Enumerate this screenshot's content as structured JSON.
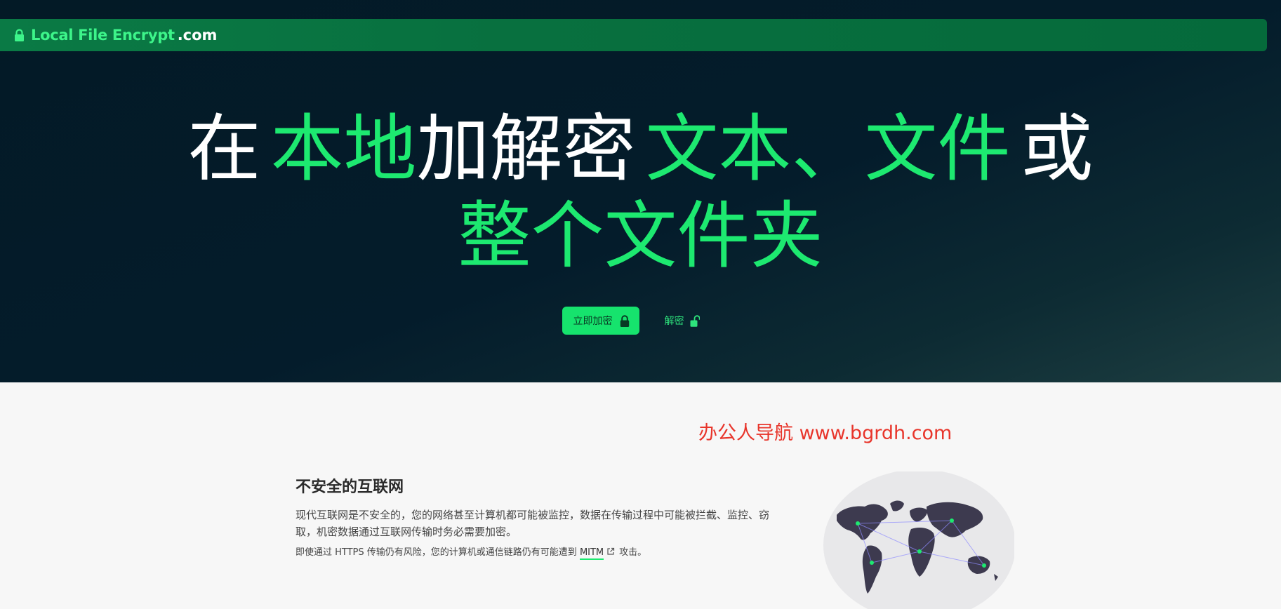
{
  "brand": {
    "name": "Local File Encrypt",
    "suffix": ".com"
  },
  "hero": {
    "line1": {
      "w1": "在",
      "g1": "本地",
      "w2": "加解密",
      "g2": "文本、",
      "g3": "文件",
      "w3": "或"
    },
    "line2": "整个文件夹",
    "encrypt_label": "立即加密",
    "decrypt_label": "解密"
  },
  "watermark": "办公人导航 www.bgrdh.com",
  "section": {
    "title": "不安全的互联网",
    "p1": "现代互联网是不安全的，您的网络甚至计算机都可能被监控，数据在传输过程中可能被拦截、监控、窃取，机密数据通过互联网传输时务必需要加密。",
    "p2_before": "即使通过 HTTPS 传输仍有风险，您的计算机或通信链路仍有可能遭到",
    "p2_link": "MITM",
    "p2_after": "攻击。"
  },
  "colors": {
    "accent": "#1de970",
    "hero_bg": "#041c2b",
    "topbar": "#08703f",
    "watermark": "#e8352b"
  },
  "icons": {
    "brand": "lock-icon",
    "encrypt": "lock-icon",
    "decrypt": "unlock-icon",
    "link": "external-link-icon",
    "illustration": "world-map-illustration"
  }
}
